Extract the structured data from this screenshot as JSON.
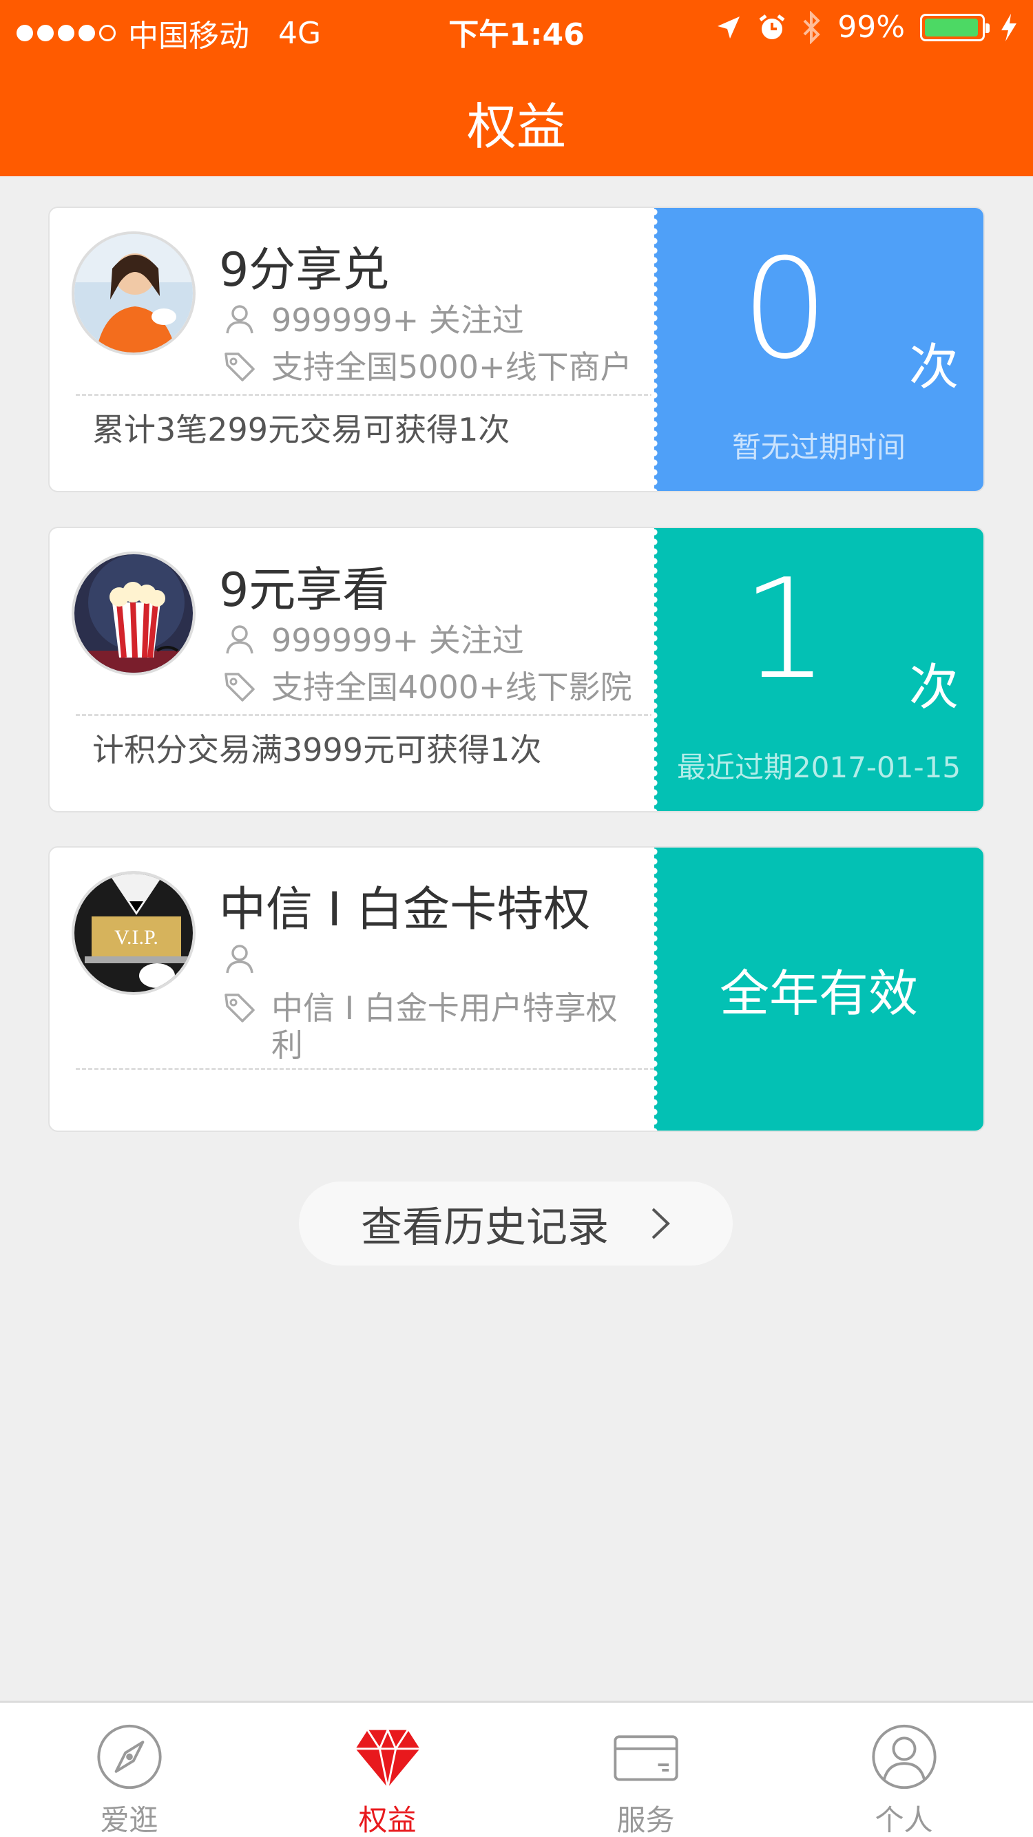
{
  "status_bar": {
    "carrier": "中国移动",
    "network": "4G",
    "time": "下午1:46",
    "battery": "99%"
  },
  "header": {
    "title": "权益"
  },
  "cards": [
    {
      "title": "9分享兑",
      "followers": "999999+ 关注过",
      "tag": "支持全国5000+线下商户",
      "note": "累计3笔299元交易可获得1次",
      "count": "0",
      "unit": "次",
      "expire": "暂无过期时间",
      "accent": "#4fa0f8"
    },
    {
      "title": "9元享看",
      "followers": "999999+ 关注过",
      "tag": "支持全国4000+线下影院",
      "note": "计积分交易满3999元可获得1次",
      "count": "1",
      "unit": "次",
      "expire": "最近过期2017-01-15",
      "accent": "#03c1b4"
    },
    {
      "title": "中信 I 白金卡特权",
      "followers": "",
      "tag_line1": "中信 I 白金卡用户特享权",
      "tag_line2": "利",
      "valid": "全年有效",
      "accent": "#03c1b4"
    }
  ],
  "history_button": {
    "label": "查看历史记录"
  },
  "tabbar": {
    "items": [
      {
        "label": "爱逛",
        "icon": "compass-icon"
      },
      {
        "label": "权益",
        "icon": "diamond-icon"
      },
      {
        "label": "服务",
        "icon": "card-icon"
      },
      {
        "label": "个人",
        "icon": "person-icon"
      }
    ],
    "active_color": "#e8191d"
  },
  "colors": {
    "brand": "#ff5b00",
    "background": "#efefef"
  }
}
